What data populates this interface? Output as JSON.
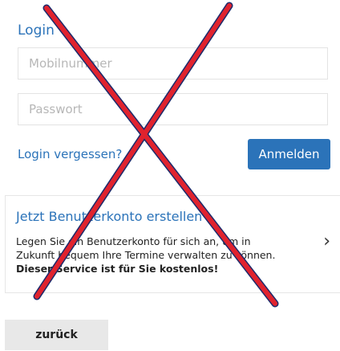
{
  "login": {
    "heading": "Login",
    "phone_placeholder": "Mobilnummer",
    "password_placeholder": "Passwort",
    "forgot_label": "Login vergessen?",
    "submit_label": "Anmelden"
  },
  "register": {
    "title": "Jetzt Benutzerkonto erstellen",
    "text": "Legen Sie ein Benutzerkonto für sich an, um in Zukunft bequem Ihre Termine verwalten zu können. ",
    "free_note": "Dieser Service ist für Sie kostenlos!",
    "chevron_icon": "chevron-right-icon"
  },
  "overlay": {
    "cross_icon": "red-cross-icon",
    "color": "#e0232e",
    "outline_color": "#1b2a6b"
  },
  "footer": {
    "back_label": "zurück"
  },
  "colors": {
    "accent": "#2b73b9",
    "back_button_bg": "#e8e8e8"
  }
}
